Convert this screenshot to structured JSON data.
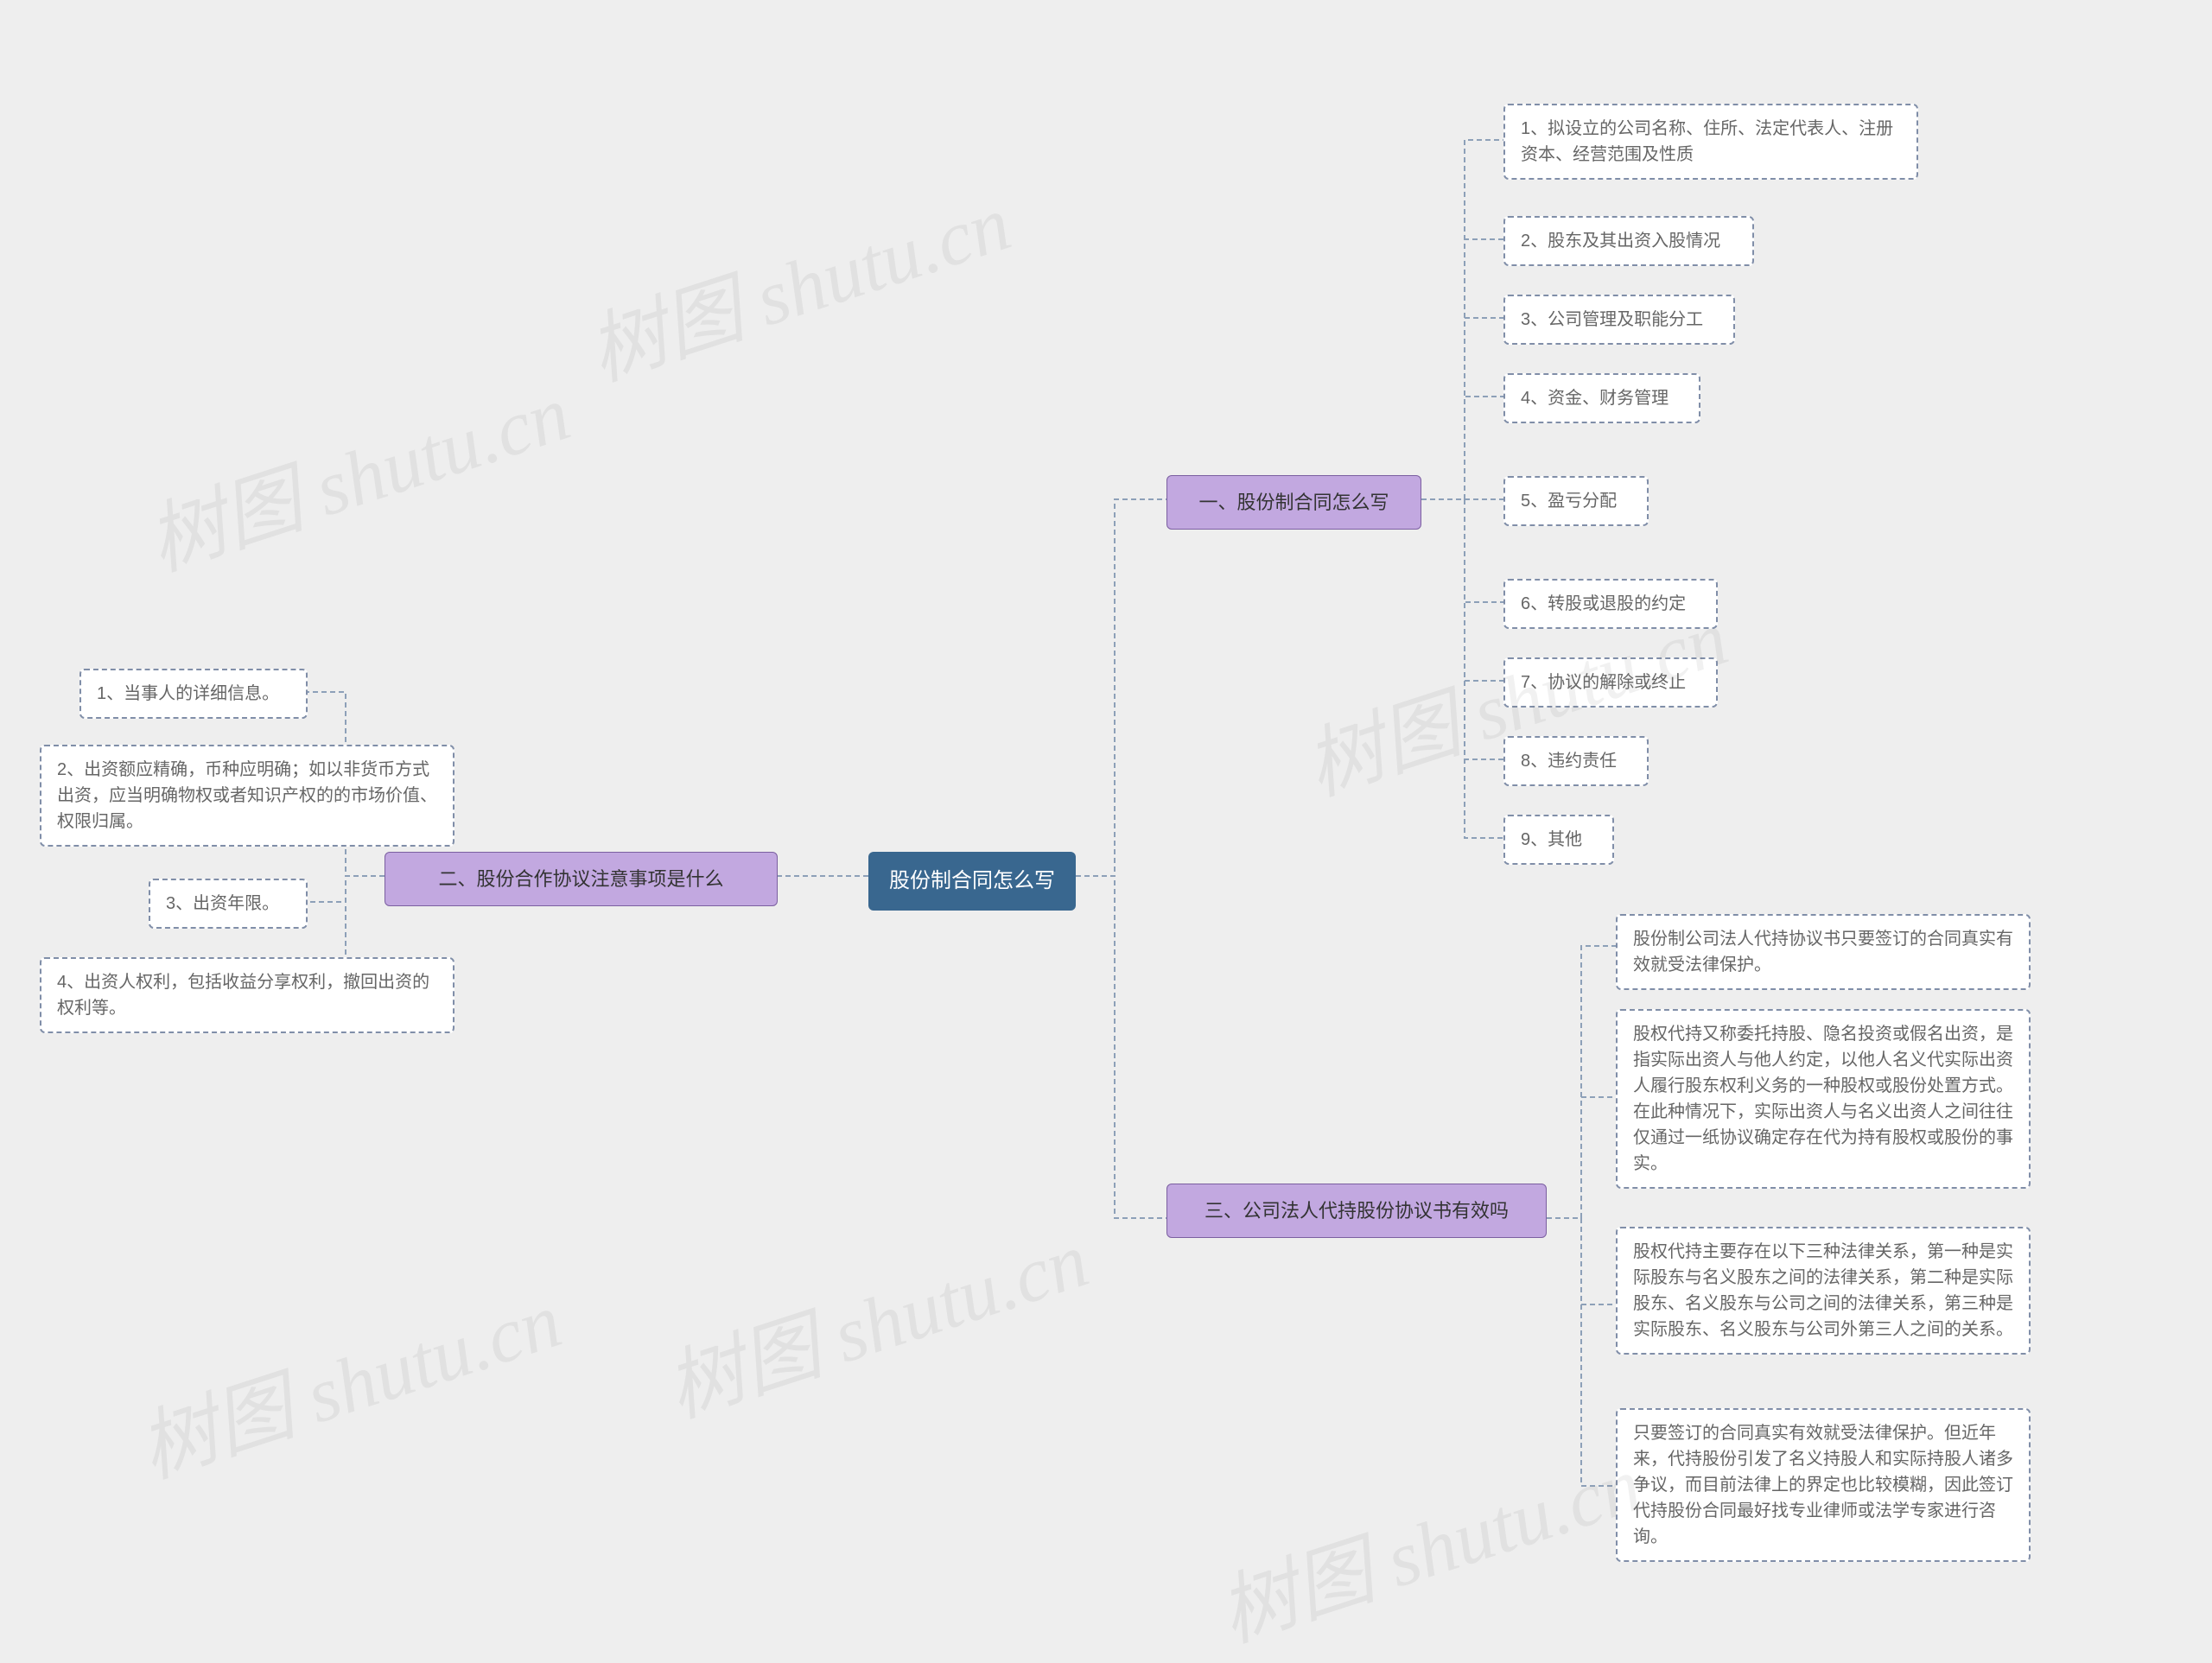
{
  "root": {
    "label": "股份制合同怎么写"
  },
  "branch_right_1": {
    "label": "一、股份制合同怎么写"
  },
  "branch_right_3": {
    "label": "三、公司法人代持股份协议书有效吗"
  },
  "branch_left_2": {
    "label": "二、股份合作协议注意事项是什么"
  },
  "r1_leaves": [
    "1、拟设立的公司名称、住所、法定代表人、注册资本、经营范围及性质",
    "2、股东及其出资入股情况",
    "3、公司管理及职能分工",
    "4、资金、财务管理",
    "5、盈亏分配",
    "6、转股或退股的约定",
    "7、协议的解除或终止",
    "8、违约责任",
    "9、其他"
  ],
  "r3_leaves": [
    "股份制公司法人代持协议书只要签订的合同真实有效就受法律保护。",
    "股权代持又称委托持股、隐名投资或假名出资，是指实际出资人与他人约定，以他人名义代实际出资人履行股东权利义务的一种股权或股份处置方式。在此种情况下，实际出资人与名义出资人之间往往仅通过一纸协议确定存在代为持有股权或股份的事实。",
    "股权代持主要存在以下三种法律关系，第一种是实际股东与名义股东之间的法律关系，第二种是实际股东、名义股东与公司之间的法律关系，第三种是实际股东、名义股东与公司外第三人之间的关系。",
    "只要签订的合同真实有效就受法律保护。但近年来，代持股份引发了名义持股人和实际持股人诸多争议，而目前法律上的界定也比较模糊，因此签订代持股份合同最好找专业律师或法学专家进行咨询。"
  ],
  "l2_leaves": [
    "1、当事人的详细信息。",
    "2、出资额应精确，币种应明确；如以非货币方式出资，应当明确物权或者知识产权的的市场价值、权限归属。",
    "3、出资年限。",
    "4、出资人权利，包括收益分享权利，撤回出资的权利等。"
  ],
  "watermark": "树图 shutu.cn"
}
